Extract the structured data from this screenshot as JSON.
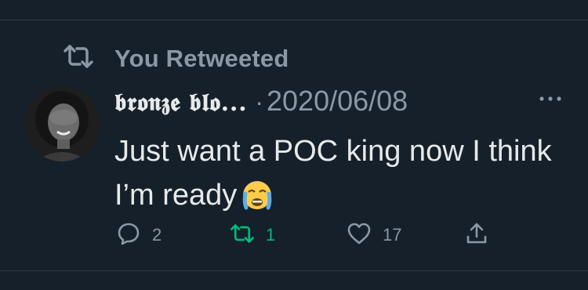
{
  "retweet_banner": {
    "label": "You Retweeted",
    "icon": "retweet-icon"
  },
  "tweet": {
    "author_display_name": "𝖇𝖗𝖔𝖓𝖟𝖊 𝖇𝖑𝖔...",
    "separator": "·",
    "date": "2020/06/08",
    "text": "Just want a POC king now I think I’m ready",
    "emoji": "loudly-crying-face"
  },
  "actions": {
    "reply": {
      "icon": "reply-icon",
      "count": "2"
    },
    "retweet": {
      "icon": "retweet-icon",
      "count": "1",
      "active": true,
      "color": "#00ba7c"
    },
    "like": {
      "icon": "heart-icon",
      "count": "17"
    },
    "share": {
      "icon": "share-icon"
    }
  },
  "colors": {
    "background": "#15202b",
    "text": "#e7e9ea",
    "muted": "#8b98a5",
    "retweet_active": "#00ba7c"
  }
}
